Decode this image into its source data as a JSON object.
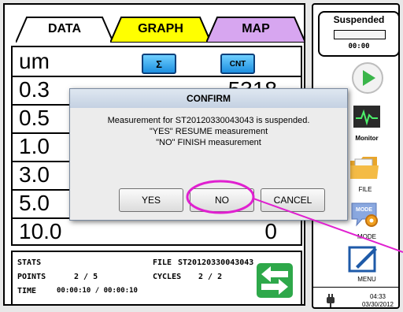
{
  "tabs": [
    {
      "label": "DATA",
      "color": "#ffffff"
    },
    {
      "label": "GRAPH",
      "color": "#ffff00"
    },
    {
      "label": "MAP",
      "color": "#d7a6f0"
    }
  ],
  "table": {
    "header_label": "um",
    "sum_button": "Σ",
    "cnt_button": "CNT",
    "rows": [
      {
        "size": "0.3",
        "count": "5318"
      },
      {
        "size": "0.5",
        "count": ""
      },
      {
        "size": "1.0",
        "count": ""
      },
      {
        "size": "3.0",
        "count": ""
      },
      {
        "size": "5.0",
        "count": ""
      },
      {
        "size": "10.0",
        "count": "0"
      }
    ]
  },
  "stats": {
    "title": "STATS",
    "file_label": "FILE",
    "file_value": "ST20120330043043",
    "points_label": "POINTS",
    "points_value": "2 / 5",
    "cycles_label": "CYCLES",
    "cycles_value": "2 / 2",
    "time_label": "TIME",
    "time_value": "00:00:10 / 00:00:10"
  },
  "side": {
    "status": "Suspended",
    "timer": "00:00",
    "monitor_label": "Monitor",
    "file_label": "FILE",
    "mode_label": "MODE",
    "menu_label": "MENU",
    "clock_time": "04:33",
    "clock_date": "03/30/2012"
  },
  "dialog": {
    "title": "CONFIRM",
    "line1": "Measurement for ST20120330043043 is suspended.",
    "line2": "\"YES\"  RESUME measurement",
    "line3": "\"NO\"   FINISH measurement",
    "yes": "YES",
    "no": "NO",
    "cancel": "CANCEL"
  },
  "colors": {
    "accent_highlight": "#e020d0",
    "play_green": "#3ab54a",
    "arrow_green": "#2ea84a"
  },
  "icons": [
    "play-icon",
    "monitor-icon",
    "folder-icon",
    "mode-icon",
    "menu-icon",
    "power-plug-icon",
    "swap-arrows-icon"
  ]
}
